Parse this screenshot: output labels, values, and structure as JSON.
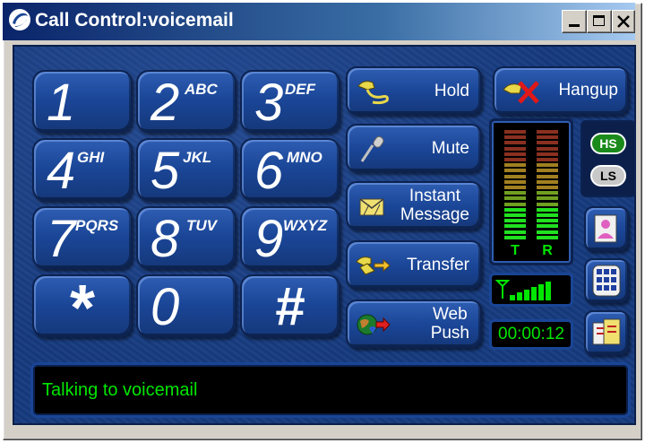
{
  "window": {
    "title": "Call Control:voicemail",
    "controls": {
      "minimize": "minimize",
      "maximize": "maximize",
      "close": "close"
    }
  },
  "keypad": [
    {
      "digit": "1",
      "letters": ""
    },
    {
      "digit": "2",
      "letters": "ABC"
    },
    {
      "digit": "3",
      "letters": "DEF"
    },
    {
      "digit": "4",
      "letters": "GHI"
    },
    {
      "digit": "5",
      "letters": "JKL"
    },
    {
      "digit": "6",
      "letters": "MNO"
    },
    {
      "digit": "7",
      "letters": "PQRS"
    },
    {
      "digit": "8",
      "letters": "TUV"
    },
    {
      "digit": "9",
      "letters": "WXYZ"
    },
    {
      "digit": "*",
      "letters": ""
    },
    {
      "digit": "0",
      "letters": ""
    },
    {
      "digit": "#",
      "letters": ""
    }
  ],
  "actions": {
    "hold": {
      "label": "Hold",
      "icon": "hold-phone-icon"
    },
    "mute": {
      "label": "Mute",
      "icon": "microphone-icon"
    },
    "instant_message": {
      "line1": "Instant",
      "line2": "Message",
      "icon": "message-icon"
    },
    "transfer": {
      "label": "Transfer",
      "icon": "transfer-phone-icon"
    },
    "web_push": {
      "line1": "Web",
      "line2": "Push",
      "icon": "globe-icon"
    },
    "hangup": {
      "label": "Hangup",
      "icon": "hangup-phone-icon"
    }
  },
  "meter": {
    "left_label": "T",
    "right_label": "R"
  },
  "audio_mode": {
    "handset": "HS",
    "loudspeaker": "LS"
  },
  "side_buttons": {
    "contact": "contact-icon",
    "keypad": "dialpad-icon",
    "conference": "conference-icon"
  },
  "signal": {
    "icon": "signal-strength-icon"
  },
  "timer": "00:00:12",
  "status": "Talking to voicemail",
  "colors": {
    "panel": "#163a7e",
    "lcd_text": "#00e600",
    "title_bar": "#0a246a"
  }
}
